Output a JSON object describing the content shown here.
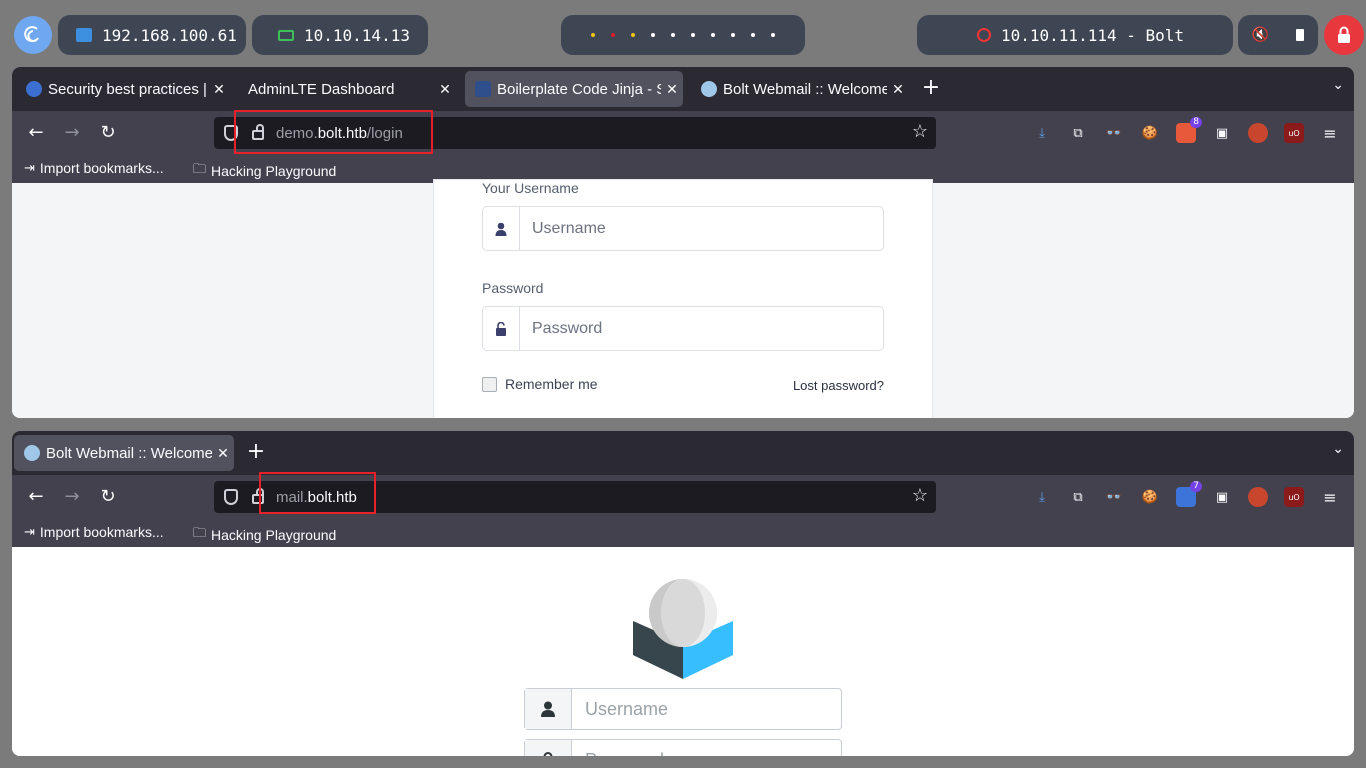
{
  "system_bar": {
    "local_ip": "192.168.100.61",
    "vpn_ip": "10.10.14.13",
    "target": "10.10.11.114 - Bolt",
    "workspace_dots": [
      "#f5c211",
      "#e01b24",
      "#f5c211",
      "#ffffff",
      "#ffffff",
      "#ffffff",
      "#ffffff",
      "#ffffff",
      "#ffffff",
      "#ffffff"
    ],
    "icons": [
      "debian-launcher-icon",
      "ethernet-icon",
      "laptop-icon",
      "target-icon",
      "mute-icon",
      "battery-icon",
      "lock-icon"
    ]
  },
  "window1": {
    "tabs": [
      {
        "label": "Security best practices | ",
        "favicon": "#3b6fd1"
      },
      {
        "label": "AdminLTE Dashboard",
        "favicon": ""
      },
      {
        "label": "Boilerplate Code Jinja - S",
        "favicon": "#2f4e8c",
        "active": true
      },
      {
        "label": "Bolt Webmail :: Welcome",
        "favicon": "#9ec7e8"
      }
    ],
    "url_prefix": "demo.",
    "url_host": "bolt.htb",
    "url_path": "/login",
    "ext_badge": "8",
    "bookmarks": [
      "Import bookmarks...",
      "Hacking Playground"
    ],
    "form": {
      "username_label": "Your Username",
      "username_placeholder": "Username",
      "password_label": "Password",
      "password_placeholder": "Password",
      "remember": "Remember me",
      "lost": "Lost password?"
    }
  },
  "window2": {
    "tabs": [
      {
        "label": "Bolt Webmail :: Welcome",
        "favicon": "#9ec7e8",
        "active": true
      }
    ],
    "url_prefix": "mail.",
    "url_host": "bolt.htb",
    "url_path": "",
    "ext_badge": "7",
    "bookmarks": [
      "Import bookmarks...",
      "Hacking Playground"
    ],
    "form": {
      "username_placeholder": "Username",
      "password_placeholder": "Password"
    }
  },
  "colors": {
    "highlight_box": "#e8202a",
    "browser_chrome": "#2b2a33",
    "toolbar": "#42414d"
  }
}
